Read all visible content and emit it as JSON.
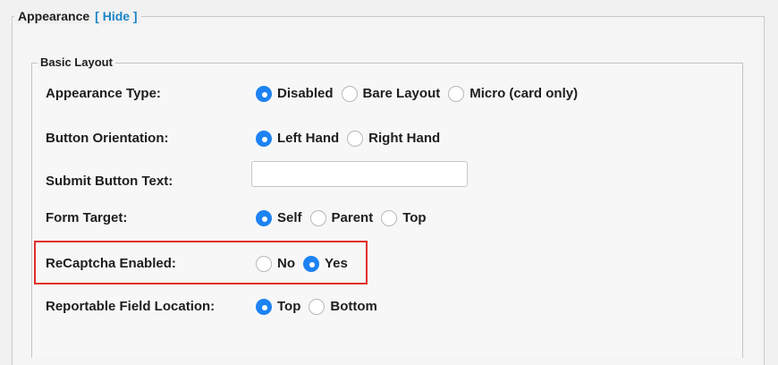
{
  "appearance_section": {
    "legend": "Appearance",
    "hide_label": "[ Hide ]"
  },
  "basic_layout": {
    "legend": "Basic Layout",
    "rows": [
      {
        "label": "Appearance Type:",
        "options": [
          {
            "label": "Disabled",
            "checked": true
          },
          {
            "label": "Bare Layout",
            "checked": false
          },
          {
            "label": "Micro (card only)",
            "checked": false
          }
        ]
      },
      {
        "label": "Button Orientation:",
        "options": [
          {
            "label": "Left Hand",
            "checked": true
          },
          {
            "label": "Right Hand",
            "checked": false
          }
        ]
      },
      {
        "label": "Submit Button Text:",
        "input_value": ""
      },
      {
        "label": "Form Target:",
        "options": [
          {
            "label": "Self",
            "checked": true
          },
          {
            "label": "Parent",
            "checked": false
          },
          {
            "label": "Top",
            "checked": false
          }
        ]
      },
      {
        "label": "ReCaptcha Enabled:",
        "options": [
          {
            "label": "No",
            "checked": false
          },
          {
            "label": "Yes",
            "checked": true
          }
        ]
      },
      {
        "label": "Reportable Field Location:",
        "options": [
          {
            "label": "Top",
            "checked": true
          },
          {
            "label": "Bottom",
            "checked": false
          }
        ]
      }
    ]
  },
  "colors": {
    "radio_selected": "#1d83f3",
    "link": "#1a86c8",
    "highlight": "#e0302a"
  }
}
